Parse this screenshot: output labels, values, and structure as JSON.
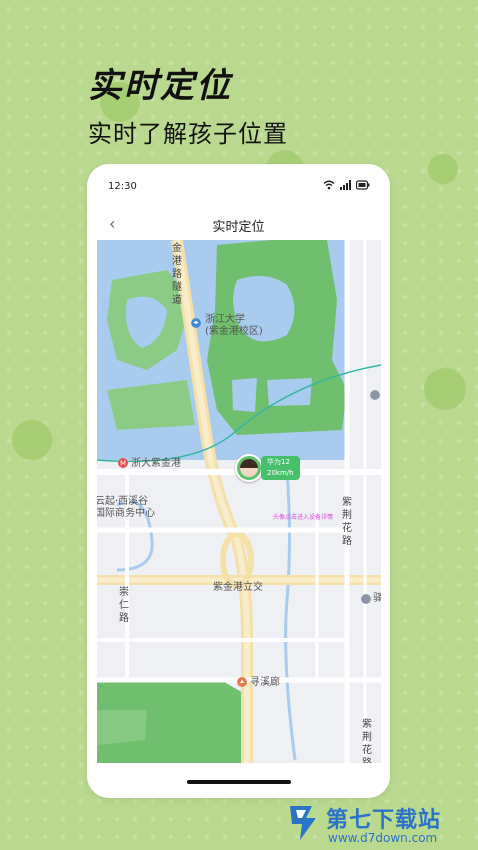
{
  "promo": {
    "headline": "实时定位",
    "subtitle": "实时了解孩子位置"
  },
  "status_bar": {
    "time": "12:30",
    "icons": [
      "wifi-icon",
      "signal-icon",
      "battery-icon"
    ]
  },
  "nav": {
    "back_icon": "chevron-left-icon",
    "title": "实时定位"
  },
  "map": {
    "labels": {
      "tunnel": "金港路隧道",
      "university": "浙江大学\n(紫金港校区)",
      "station": "浙大紫金港",
      "building": "云起·西溪谷\n国际商务中心",
      "interchange": "紫金港立交",
      "road_left": "崇仁路",
      "road_right_top": "紫荆花路",
      "road_right_bottom": "紫荆花路",
      "xunxi": "寻溪廊",
      "partial_right": "驿"
    },
    "device": {
      "name": "华为12",
      "speed": "20km/h",
      "hint": "头像点击进入设备详情"
    }
  },
  "watermark": {
    "name": "第七下载站",
    "url": "www.d7down.com"
  },
  "colors": {
    "background": "#b9d98f",
    "accent_green": "#46c06a",
    "water": "#a9cbee",
    "park": "#6fbf6f",
    "watermark_blue": "#2a73c8"
  }
}
